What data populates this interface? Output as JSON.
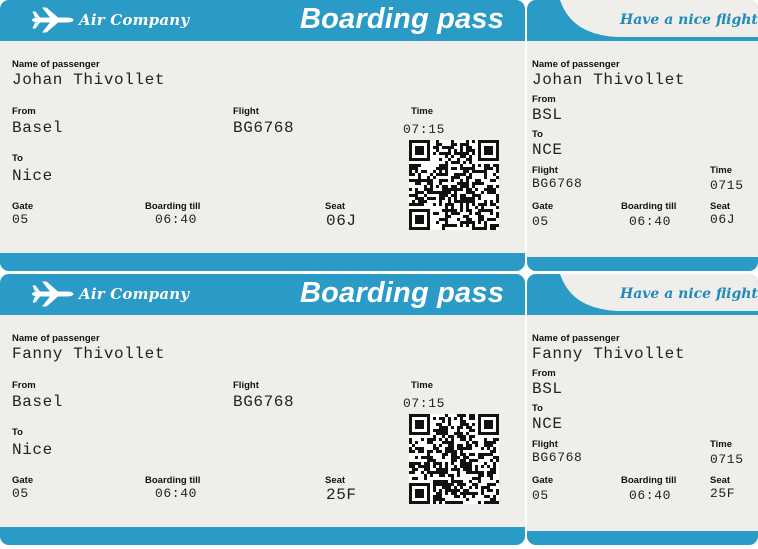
{
  "colors": {
    "accent": "#2a9ac6",
    "paper": "#efeeea"
  },
  "icons": {
    "logo": "airplane-icon"
  },
  "labels": {
    "company": "Air Company",
    "title": "Boarding pass",
    "slogan": "Have a nice flight",
    "name": "Name of passenger",
    "from": "From",
    "to": "To",
    "flight": "Flight",
    "time": "Time",
    "gate": "Gate",
    "boarding": "Boarding till",
    "seat": "Seat"
  },
  "passes": [
    {
      "passenger": "Johan Thivollet",
      "from": "Basel",
      "to": "Nice",
      "from_code": "BSL",
      "to_code": "NCE",
      "flight": "BG6768",
      "time": "07:15",
      "time_stub": "0715",
      "gate": "05",
      "boarding": "06:40",
      "seat": "06J"
    },
    {
      "passenger": "Fanny Thivollet",
      "from": "Basel",
      "to": "Nice",
      "from_code": "BSL",
      "to_code": "NCE",
      "flight": "BG6768",
      "time": "07:15",
      "time_stub": "0715",
      "gate": "05",
      "boarding": "06:40",
      "seat": "25F"
    }
  ]
}
